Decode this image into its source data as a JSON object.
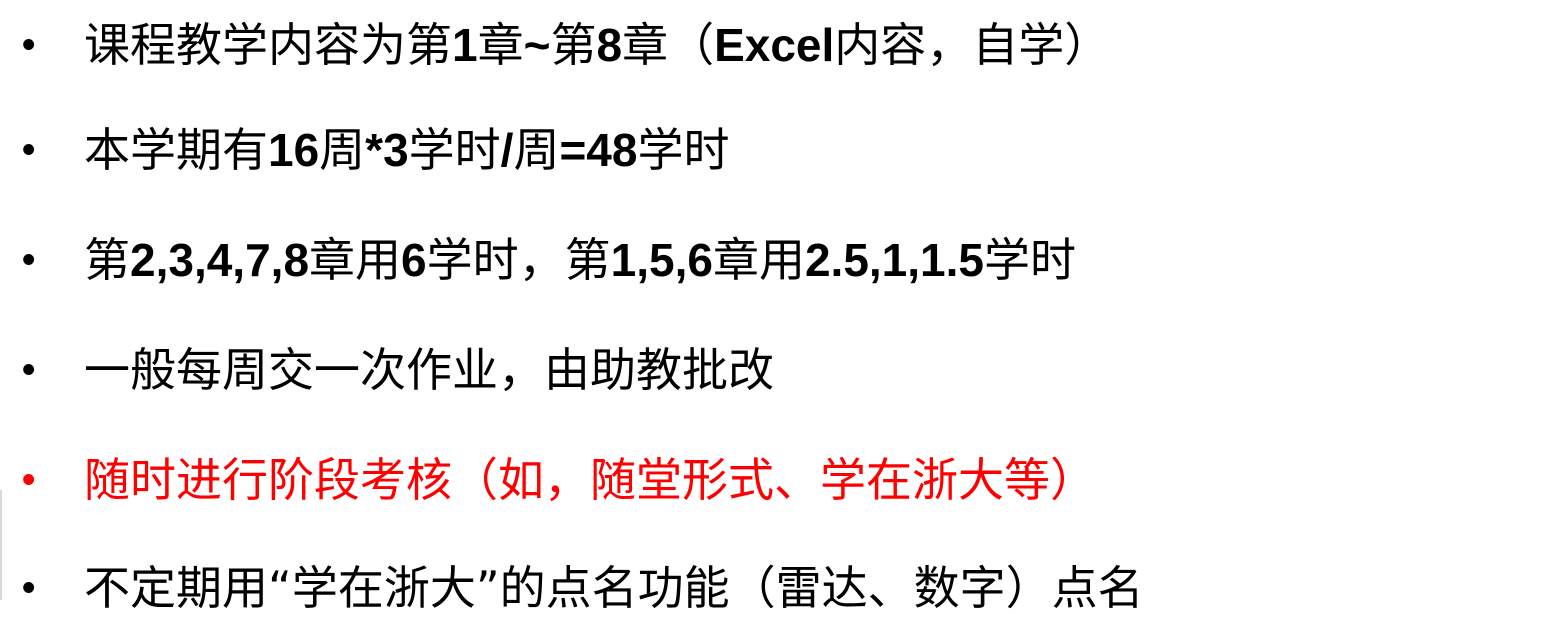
{
  "slide": {
    "colors": {
      "text": "#000000",
      "highlight": "#ff0000",
      "background": "#ffffff"
    },
    "bullet_symbol": "•",
    "bullets": [
      {
        "segments": [
          {
            "text": "课程教学内容为第",
            "bold": false
          },
          {
            "text": "1",
            "bold": true
          },
          {
            "text": "章",
            "bold": false
          },
          {
            "text": "~",
            "bold": true
          },
          {
            "text": "第",
            "bold": false
          },
          {
            "text": "8",
            "bold": true
          },
          {
            "text": "章（",
            "bold": false
          },
          {
            "text": "Excel",
            "bold": true
          },
          {
            "text": "内容，自学）",
            "bold": false
          }
        ],
        "color": "#000000"
      },
      {
        "segments": [
          {
            "text": "本学期有",
            "bold": false
          },
          {
            "text": "16",
            "bold": true
          },
          {
            "text": "周",
            "bold": false
          },
          {
            "text": "*3",
            "bold": true
          },
          {
            "text": "学时",
            "bold": false
          },
          {
            "text": "/",
            "bold": true
          },
          {
            "text": "周",
            "bold": false
          },
          {
            "text": "=48",
            "bold": true
          },
          {
            "text": "学时",
            "bold": false
          }
        ],
        "color": "#000000"
      },
      {
        "segments": [
          {
            "text": "第",
            "bold": false
          },
          {
            "text": "2,3,4,7,8",
            "bold": true
          },
          {
            "text": "章用",
            "bold": false
          },
          {
            "text": "6",
            "bold": true
          },
          {
            "text": "学时，第",
            "bold": false
          },
          {
            "text": "1,5,6",
            "bold": true
          },
          {
            "text": "章用",
            "bold": false
          },
          {
            "text": "2.5,1,1.5",
            "bold": true
          },
          {
            "text": "学时",
            "bold": false
          }
        ],
        "color": "#000000"
      },
      {
        "segments": [
          {
            "text": "一般每周交一次作业，由助教批改",
            "bold": false
          }
        ],
        "color": "#000000"
      },
      {
        "segments": [
          {
            "text": "随时进行阶段考核（如，随堂形式、学在浙大等）",
            "bold": false
          }
        ],
        "color": "#ff0000"
      },
      {
        "segments": [
          {
            "text": "不定期用“学在浙大”的点名功能（雷达、数字）点名",
            "bold": false
          }
        ],
        "color": "#000000"
      }
    ]
  }
}
